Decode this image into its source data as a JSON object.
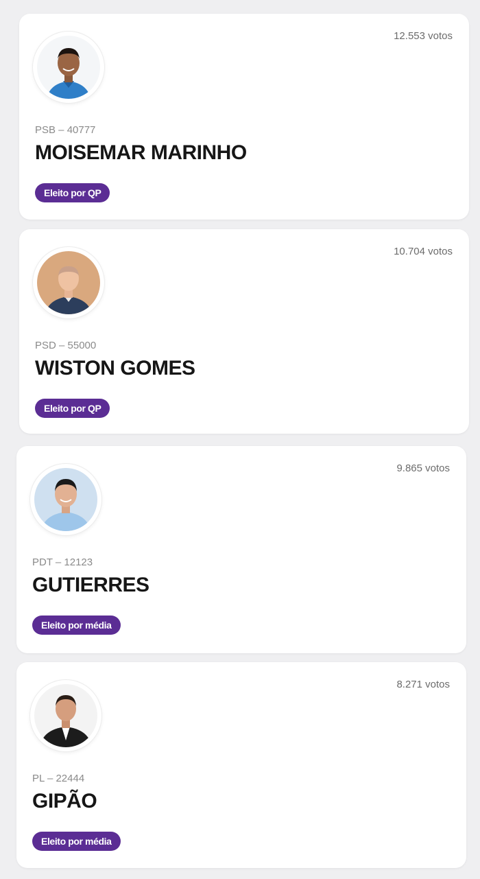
{
  "candidates": [
    {
      "votes": "12.553 votos",
      "party": "PSB – 40777",
      "name": "MOISEMAR MARINHO",
      "status": "Eleito por QP",
      "photo": "candidate-photo"
    },
    {
      "votes": "10.704 votos",
      "party": "PSD – 55000",
      "name": "WISTON GOMES",
      "status": "Eleito por QP",
      "photo": "candidate-photo"
    },
    {
      "votes": "9.865 votos",
      "party": "PDT – 12123",
      "name": "GUTIERRES",
      "status": "Eleito por média",
      "photo": "candidate-photo"
    },
    {
      "votes": "8.271 votos",
      "party": "PL – 22444",
      "name": "GIPÃO",
      "status": "Eleito por média",
      "photo": "candidate-photo"
    }
  ],
  "colors": {
    "badge": "#5b2d94",
    "background": "#efeff1",
    "card": "#ffffff"
  }
}
